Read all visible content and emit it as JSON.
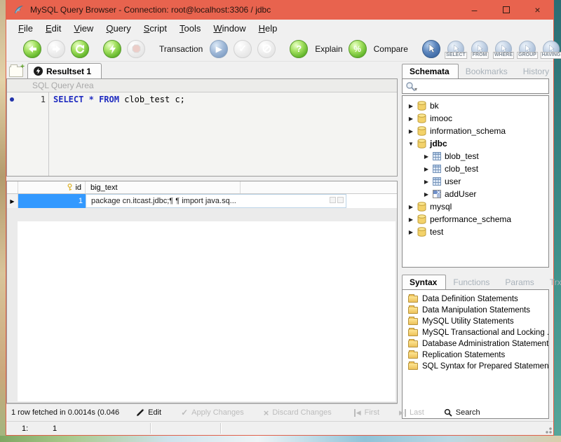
{
  "colors": {
    "titlebar": "#e8634e",
    "selection_blue": "#3399ff",
    "sql_keyword_blue": "#1f2bc0",
    "toolbar_green": "#67b92f"
  },
  "icons": {
    "arrow_right": "▶",
    "arrow_down": "▼",
    "minimize": "–",
    "close": "×",
    "play": "▶",
    "check": "✓",
    "x_mark": "×",
    "prev": "◀",
    "next": "▶",
    "question": "?",
    "percent": "%",
    "search_caret": "▾",
    "row_marker": "▶",
    "new_tab_plus": "+"
  },
  "window": {
    "title": "MySQL Query Browser - Connection: root@localhost:3306 / jdbc"
  },
  "menu": {
    "items": [
      "File",
      "Edit",
      "View",
      "Query",
      "Script",
      "Tools",
      "Window",
      "Help"
    ]
  },
  "toolbar": {
    "transaction_label": "Transaction",
    "explain_label": "Explain",
    "compare_label": "Compare",
    "query_buttons": [
      "SELECT",
      "FROM",
      "WHERE",
      "GROUP",
      "HAVING"
    ]
  },
  "editor": {
    "tab_label": "Resultset 1",
    "header_label": "SQL Query Area",
    "line_number": "1",
    "sql": {
      "kw1": "SELECT",
      "star": "*",
      "kw2": "FROM",
      "rest": "clob_test c;"
    }
  },
  "grid": {
    "columns": [
      "id",
      "big_text"
    ],
    "col_id": "id",
    "col_big_text": "big_text",
    "row": {
      "id": "1",
      "big_text": "package cn.itcast.jdbc;¶ ¶ import java.sq..."
    }
  },
  "result_toolbar": {
    "status": "1 row fetched in 0.0014s (0.046",
    "edit": "Edit",
    "apply": "Apply Changes",
    "discard": "Discard Changes",
    "first": "First",
    "last": "Last",
    "search": "Search"
  },
  "statusbar": {
    "row_label": "1:",
    "col_label": "1"
  },
  "sidebar": {
    "tabs": [
      "Schemata",
      "Bookmarks",
      "History"
    ],
    "tree": [
      {
        "label": "bk",
        "type": "database"
      },
      {
        "label": "imooc",
        "type": "database"
      },
      {
        "label": "information_schema",
        "type": "database"
      },
      {
        "label": "jdbc",
        "type": "database",
        "expanded": true
      },
      {
        "label": "blob_test",
        "type": "table"
      },
      {
        "label": "clob_test",
        "type": "table"
      },
      {
        "label": "user",
        "type": "table"
      },
      {
        "label": "addUser",
        "type": "procedure"
      },
      {
        "label": "mysql",
        "type": "database"
      },
      {
        "label": "performance_schema",
        "type": "database"
      },
      {
        "label": "test",
        "type": "database"
      }
    ],
    "syntax_tabs": [
      "Syntax",
      "Functions",
      "Params",
      "Trx"
    ],
    "syntax_items": [
      "Data Definition Statements",
      "Data Manipulation Statements",
      "MySQL Utility Statements",
      "MySQL Transactional and Locking ...",
      "Database Administration Statements",
      "Replication Statements",
      "SQL Syntax for Prepared Statements"
    ]
  }
}
